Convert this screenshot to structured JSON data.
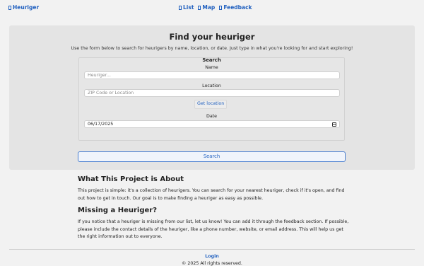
{
  "nav": {
    "brand": "Heuriger",
    "links": [
      {
        "label": "List",
        "icon": "list-icon"
      },
      {
        "label": "Map",
        "icon": "map-icon"
      },
      {
        "label": "Feedback",
        "icon": "feedback-icon"
      }
    ]
  },
  "hero": {
    "title": "Find your heuriger",
    "subtitle": "Use the form below to search for heurigers by name, location, or date. Just type in what you're looking for and start exploring!"
  },
  "form": {
    "legend": "Search",
    "name_label": "Name",
    "name_placeholder": "Heuriger...",
    "location_label": "Location",
    "location_placeholder": "ZIP Code or Location",
    "geo_button": "Get location",
    "date_label": "Date",
    "date_value": "06/17/2025",
    "search_button": "Search"
  },
  "about": {
    "heading": "What This Project is About",
    "text": "This project is simple: it's a collection of heurigers. You can search for your nearest heuriger, check if it's open, and find out how to get in touch. Our goal is to make finding a heuriger as easy as possible."
  },
  "missing": {
    "heading": "Missing a Heuriger?",
    "text": "If you notice that a heuriger is missing from our list, let us know! You can add it through the feedback section. If possible, please include the contact details of the heuriger, like a phone number, website, or email address. This will help us get the right information out to everyone."
  },
  "footer": {
    "login": "Login",
    "copyright": "© 2025 All rights reserved."
  },
  "colors": {
    "link": "#1f5fbf",
    "hero_bg": "#e4e4e4",
    "page_bg": "#f2f2f2"
  }
}
